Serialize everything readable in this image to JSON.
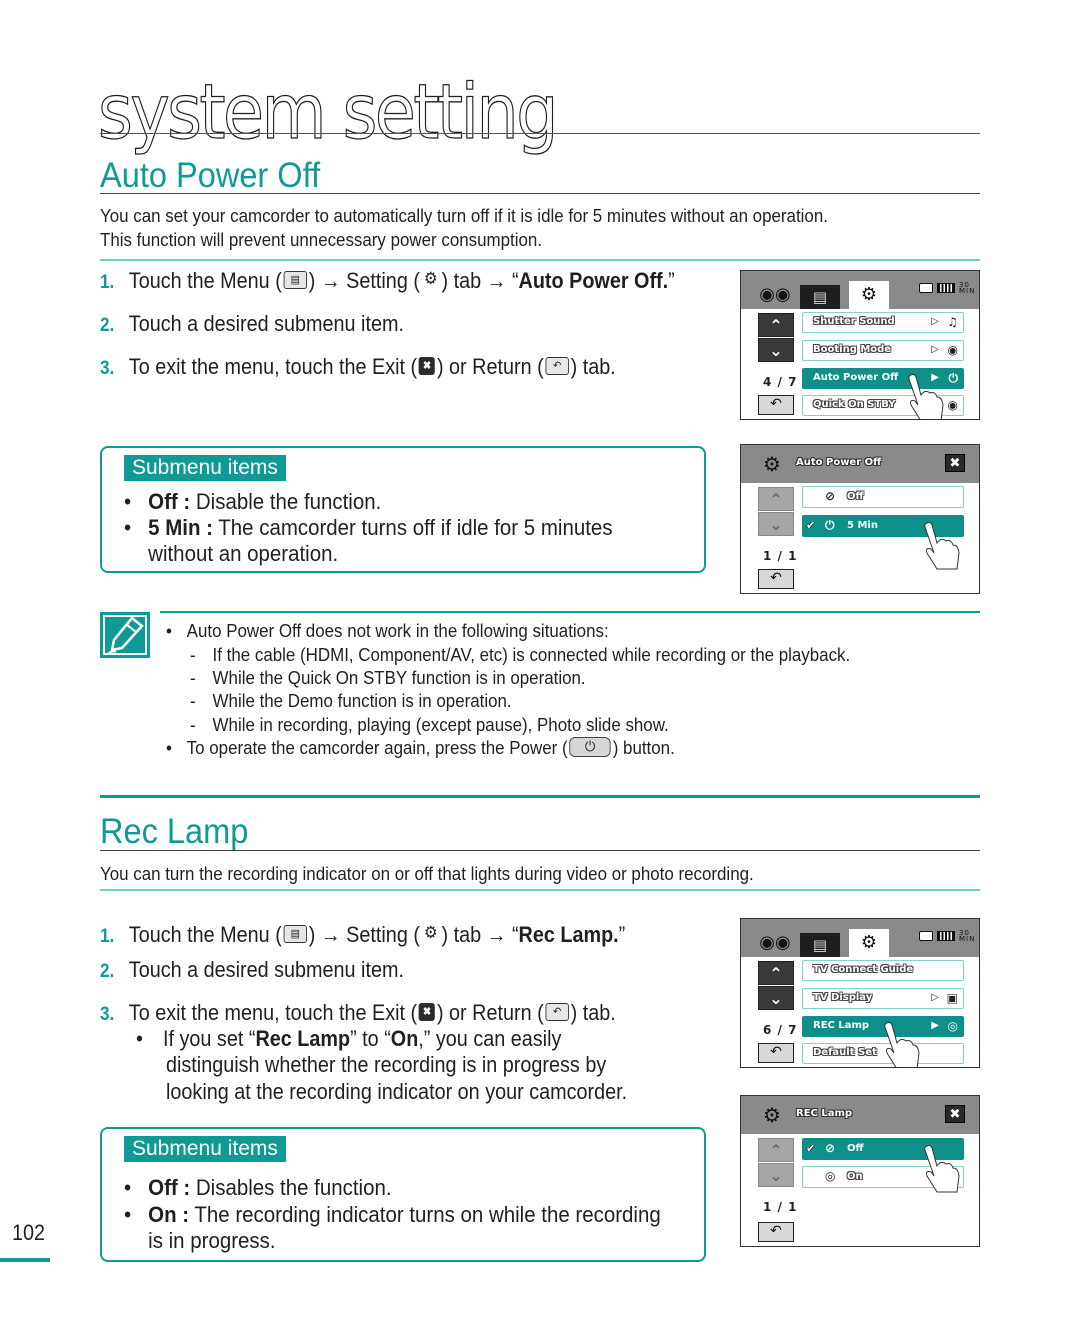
{
  "chapter": {
    "title": "system setting"
  },
  "page_number": "102",
  "colors": {
    "accent": "#0f9a96",
    "selected_row": "#0f8f8a",
    "row_border": "#7fd3cd"
  },
  "auto_power_off": {
    "title": "Auto Power Off",
    "intro": [
      "You can set your camcorder to automatically turn off if it is idle for 5 minutes without an operation.",
      "This function will prevent unnecessary power consumption."
    ],
    "steps": [
      {
        "num": "1.",
        "pre": "Touch the Menu (",
        "menu_icon": "menu-icon",
        "mid1": ") → Setting (",
        "gear_icon": "gear-icon",
        "mid2": ") tab → “",
        "target": "Auto Power Off.",
        "post": "”"
      },
      {
        "num": "2.",
        "text": "Touch a desired submenu item."
      },
      {
        "num": "3.",
        "pre": "To exit the menu, touch the Exit (",
        "exit_icon": "exit-icon",
        "mid": ") or Return (",
        "return_icon": "return-icon",
        "post": ") tab."
      }
    ],
    "submenu": {
      "label": "Submenu items",
      "items": [
        {
          "term": "Off :",
          "desc": " Disable the function."
        },
        {
          "term": "5 Min :",
          "desc": " The camcorder turns off if idle for 5 minutes",
          "cont": "without an operation."
        }
      ]
    },
    "screen_menu": {
      "tabs": [
        "camera-tab",
        "menu-tab",
        "settings-tab"
      ],
      "page": "4 / 7",
      "rows": [
        {
          "label": "Shutter Sound",
          "arrow": "▷",
          "icon": "speaker-icon",
          "selected": false
        },
        {
          "label": "Booting Mode",
          "arrow": "▷",
          "icon": "camcorder-icon",
          "selected": false
        },
        {
          "label": "Auto Power Off",
          "arrow": "▶",
          "icon": "power-timer-icon",
          "selected": true
        },
        {
          "label": "Quick On STBY",
          "arrow": "▷",
          "icon": "quick-on-icon",
          "selected": false
        }
      ]
    },
    "screen_popup": {
      "title": "Auto Power Off",
      "page": "1 / 1",
      "options": [
        {
          "label": "Off",
          "icon": "power-off-icon",
          "selected": false
        },
        {
          "label": "5 Min",
          "icon": "power-timer-icon",
          "selected": true
        }
      ]
    },
    "note": {
      "bullet1": "Auto Power Off does not work in the following situations:",
      "sub": [
        "If the cable (HDMI, Component/AV, etc) is connected while recording or the playback.",
        "While the Quick On STBY function is in operation.",
        "While the Demo function is in operation.",
        "While in recording, playing (except pause), Photo slide show."
      ],
      "bullet2_pre": "To operate the camcorder again, press the Power (",
      "bullet2_post": ") button."
    }
  },
  "rec_lamp": {
    "title": "Rec Lamp",
    "intro": "You can turn the recording indicator on or off that lights during video or photo recording.",
    "steps": [
      {
        "num": "1.",
        "pre": "Touch the Menu (",
        "mid1": ") → Setting (",
        "mid2": ") tab → “",
        "target": "Rec Lamp.",
        "post": "”"
      },
      {
        "num": "2.",
        "text": "Touch a desired submenu item."
      },
      {
        "num": "3.",
        "pre": "To exit the menu, touch the Exit (",
        "mid": ") or Return (",
        "post": ") tab."
      }
    ],
    "tip": {
      "pre": "If you set “",
      "b1": "Rec Lamp",
      "mid": "” to “",
      "b2": "On",
      "post": ",” you can easily",
      "line2": "distinguish whether the recording is in progress by",
      "line3": "looking at the recording indicator on your camcorder."
    },
    "submenu": {
      "label": "Submenu items",
      "items": [
        {
          "term": "Off :",
          "desc": " Disables the function."
        },
        {
          "term": "On :",
          "desc": " The recording indicator turns on while the recording",
          "cont": "is in progress."
        }
      ]
    },
    "screen_menu": {
      "page": "6 / 7",
      "rows": [
        {
          "label": "TV Connect Guide",
          "arrow": "",
          "icon": "",
          "selected": false
        },
        {
          "label": "TV Display",
          "arrow": "▷",
          "icon": "tv-icon",
          "selected": false
        },
        {
          "label": "REC Lamp",
          "arrow": "▶",
          "icon": "rec-lamp-icon",
          "selected": true
        },
        {
          "label": "Default Set",
          "arrow": "",
          "icon": "",
          "selected": false
        }
      ]
    },
    "screen_popup": {
      "title": "REC Lamp",
      "page": "1 / 1",
      "options": [
        {
          "label": "Off",
          "icon": "rec-lamp-off-icon",
          "selected": true
        },
        {
          "label": "On",
          "icon": "rec-lamp-icon",
          "selected": false
        }
      ]
    }
  },
  "glyphs": {
    "bullet": "•",
    "dash": "-",
    "check": "✔",
    "up": "⌃",
    "down": "⌄",
    "return": "↶",
    "close": "✖",
    "gear": "⚙",
    "menu": "☰",
    "camera": "🎥",
    "power": "⏻",
    "speaker": "🔊",
    "camcorder": "⎈",
    "tv": "▣",
    "lamp": "◎",
    "lamp_off": "⊘",
    "status_min": "30 MIN"
  }
}
